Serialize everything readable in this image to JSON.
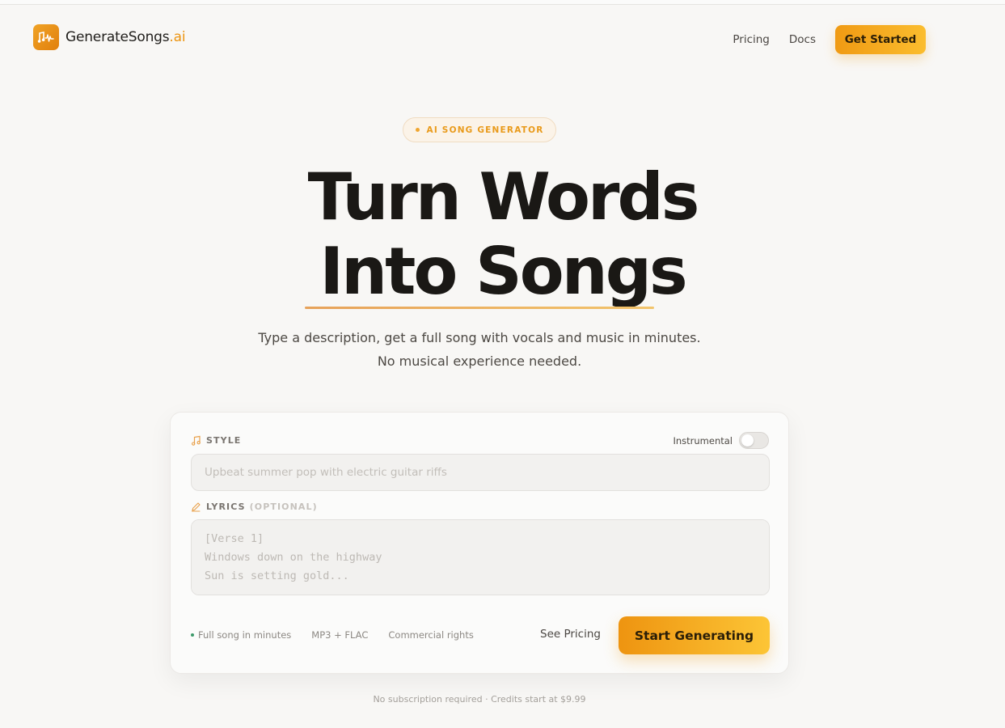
{
  "header": {
    "logo_name": "GenerateSongs",
    "logo_tld": ".ai",
    "nav": [
      {
        "label": "Pricing"
      },
      {
        "label": "Docs"
      }
    ],
    "cta_label": "Get Started"
  },
  "hero": {
    "badge": "AI SONG GENERATOR",
    "title_line1": "Turn Words",
    "title_line2": "Into Songs",
    "subtitle": "Type a description, get a full song with vocals and music in minutes. No musical experience needed."
  },
  "form": {
    "style_label": "STYLE",
    "instrumental_label": "Instrumental",
    "instrumental_on": false,
    "style_placeholder": "Upbeat summer pop with electric guitar riffs",
    "lyrics_label": "LYRICS",
    "lyrics_optional": "(OPTIONAL)",
    "lyrics_placeholder": "[Verse 1]\nWindows down on the highway\nSun is setting gold...",
    "features": [
      "Full song in minutes",
      "MP3 + FLAC",
      "Commercial rights"
    ],
    "see_pricing": "See Pricing",
    "generate_label": "Start Generating"
  },
  "footnote": "No subscription required · Credits start at $9.99",
  "colors": {
    "accent": "#f0a326",
    "accent_light": "#fcc536",
    "background": "#f8f7f5",
    "text": "#1a1815"
  },
  "icons": {
    "logo": "waveform-music-icon",
    "style": "music-note-icon",
    "lyrics": "pencil-icon"
  }
}
